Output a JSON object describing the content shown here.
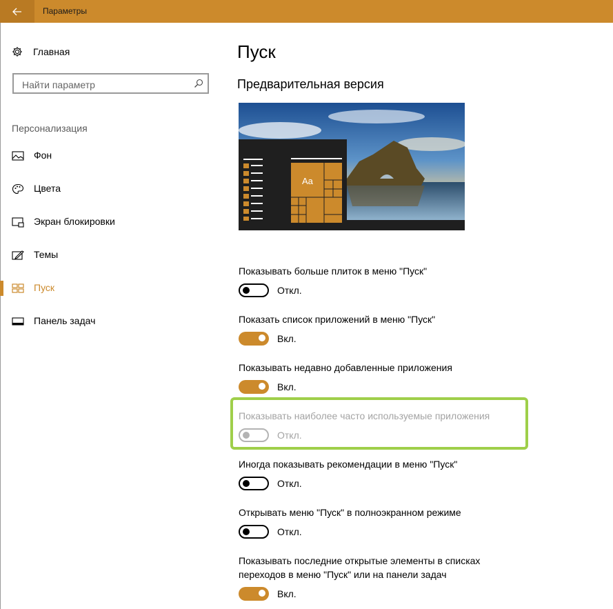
{
  "window": {
    "title": "Параметры"
  },
  "sidebar": {
    "home_label": "Главная",
    "search_placeholder": "Найти параметр",
    "section_label": "Персонализация",
    "items": [
      {
        "label": "Фон",
        "icon": "picture-icon"
      },
      {
        "label": "Цвета",
        "icon": "palette-icon"
      },
      {
        "label": "Экран блокировки",
        "icon": "lock-screen-icon"
      },
      {
        "label": "Темы",
        "icon": "themes-icon"
      },
      {
        "label": "Пуск",
        "icon": "start-icon",
        "active": true
      },
      {
        "label": "Панель задач",
        "icon": "taskbar-icon"
      }
    ]
  },
  "main": {
    "title": "Пуск",
    "preview_title": "Предварительная версия",
    "preview_tile_text": "Aa",
    "settings": [
      {
        "label": "Показывать больше плиток в меню \"Пуск\"",
        "state": "Откл.",
        "on": false
      },
      {
        "label": "Показать список приложений в меню \"Пуск\"",
        "state": "Вкл.",
        "on": true
      },
      {
        "label": "Показывать недавно добавленные приложения",
        "state": "Вкл.",
        "on": true
      },
      {
        "label": "Показывать наиболее часто используемые приложения",
        "state": "Откл.",
        "on": false,
        "disabled": true
      },
      {
        "label": "Иногда показывать рекомендации в меню \"Пуск\"",
        "state": "Откл.",
        "on": false
      },
      {
        "label": "Открывать меню \"Пуск\" в полноэкранном режиме",
        "state": "Откл.",
        "on": false
      },
      {
        "label": "Показывать последние открытые элементы в списках переходов в меню \"Пуск\" или на панели задач",
        "state": "Вкл.",
        "on": true
      }
    ]
  },
  "colors": {
    "accent": "#cc8a2c",
    "highlight_border": "#9fcf4a"
  }
}
